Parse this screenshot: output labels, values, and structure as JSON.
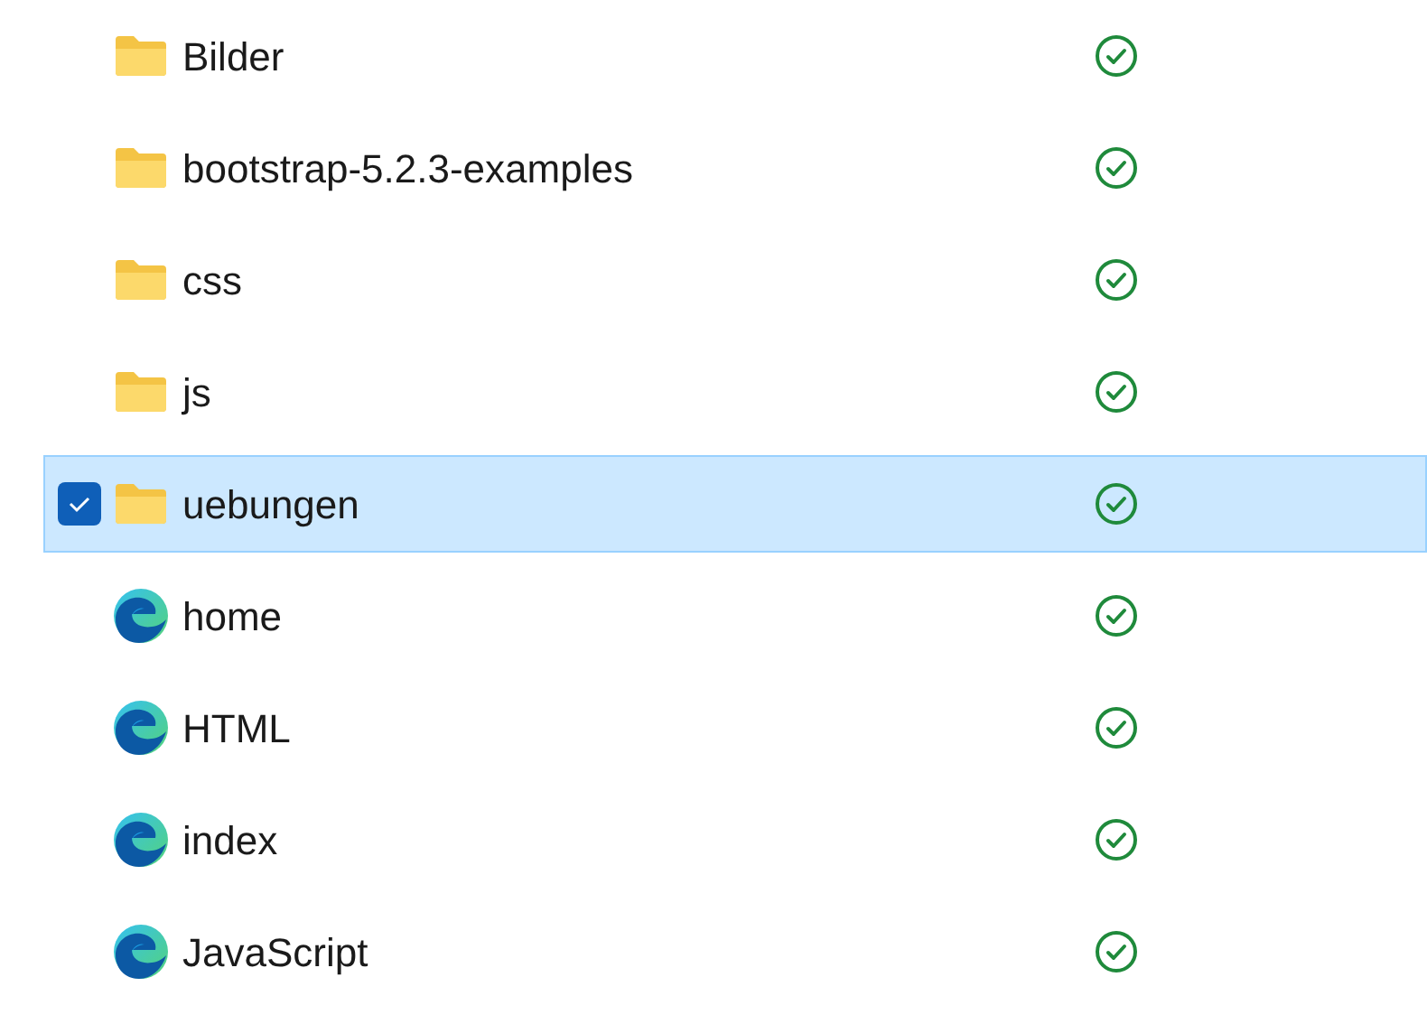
{
  "files": [
    {
      "name": "Bilder",
      "kind": "folder",
      "selected": false,
      "synced": true
    },
    {
      "name": "bootstrap-5.2.3-examples",
      "kind": "folder",
      "selected": false,
      "synced": true
    },
    {
      "name": "css",
      "kind": "folder",
      "selected": false,
      "synced": true
    },
    {
      "name": "js",
      "kind": "folder",
      "selected": false,
      "synced": true
    },
    {
      "name": "uebungen",
      "kind": "folder",
      "selected": true,
      "synced": true
    },
    {
      "name": "home",
      "kind": "html",
      "selected": false,
      "synced": true
    },
    {
      "name": "HTML",
      "kind": "html",
      "selected": false,
      "synced": true
    },
    {
      "name": "index",
      "kind": "html",
      "selected": false,
      "synced": true
    },
    {
      "name": "JavaScript",
      "kind": "html",
      "selected": false,
      "synced": true
    }
  ]
}
